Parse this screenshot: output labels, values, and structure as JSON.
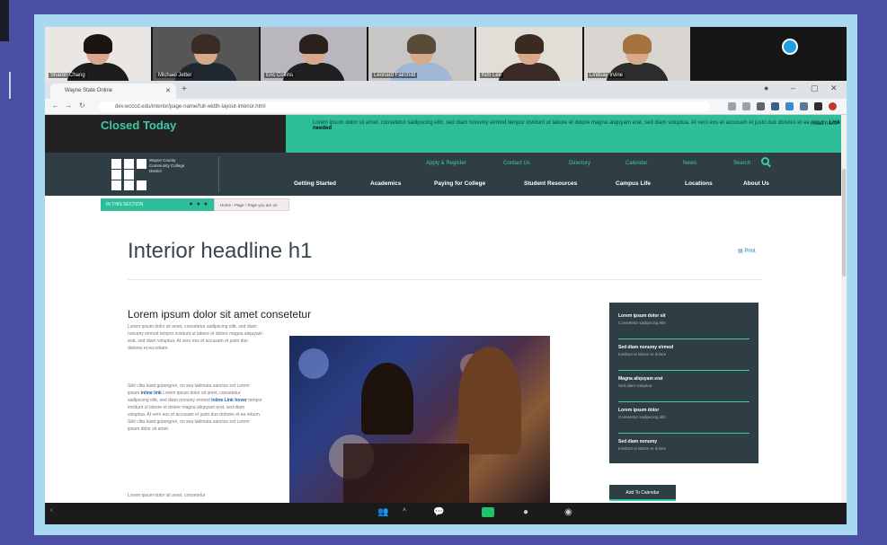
{
  "participants": [
    {
      "name": "Sharon Chang",
      "bg": "#e9e6e3",
      "hair": "#1b1410",
      "shirt": "#1d1d1d"
    },
    {
      "name": "Michael Jetter",
      "bg": "#565656",
      "hair": "#3a2c24",
      "shirt": "#1f2731"
    },
    {
      "name": "Eric Collins",
      "bg": "#b9b7bd",
      "hair": "#2a211c",
      "shirt": "#202020"
    },
    {
      "name": "Leonard Fairchild",
      "bg": "#c8c6c4",
      "hair": "#5a4a3a",
      "shirt": "#9fb6d6"
    },
    {
      "name": "Kim Lee",
      "bg": "#e1ded8",
      "hair": "#3b2a20",
      "shirt": "#3a2a28"
    },
    {
      "name": "Lindsay Irvine",
      "bg": "#d9d6d2",
      "hair": "#a6733f",
      "shirt": "#2c2c2c"
    }
  ],
  "browser": {
    "tab_title": "Wayne State Online",
    "url": "dev.wcccd.edu/interior/page-name/full-width-layout-interior.html"
  },
  "site": {
    "alert_title": "Closed Today",
    "alert_message": "Lorem ipsum dolor sit amet, consetetur sadipscing elitr, sed diam nonumy eirmod tempor invidunt ut labore et dolore magna aliquyam erat, sed diam voluptua. At vero eos et accusam et justo duo dolores et ea rebum.",
    "alert_link": "Link if needed",
    "alert_more": "Read more",
    "logo_text": "Wayne County Community College District",
    "utility_nav": [
      "Apply & Register",
      "Contact Us",
      "Directory",
      "Calendar",
      "News"
    ],
    "search_label": "Search",
    "main_nav": [
      "Getting Started",
      "Academics",
      "Paying for College",
      "Student Resources",
      "Campus Life",
      "Locations",
      "About Us"
    ],
    "crumb_label": "IN THIS SECTION",
    "crumb_path": "Home › Page › Page you are on",
    "h1": "Interior headline h1",
    "print_label": "Print",
    "h2": "Lorem ipsum dolor sit amet consetetur",
    "para1": "Lorem ipsum dolor sit amet, consetetur sadipscing elitr, sed diam nonumy eirmod tempor invidunt ut labore et dolore magna aliquyam erat, sed diam voluptua. At vero eos et accusam et justo duo dolores et ea rebum.",
    "para2_a": "Stet clita kasd gubergren, no sea takimata sanctus est Lorem ipsum",
    "inline_link_1": "inline link",
    "para2_b": "Lorem ipsum dolor sit amet, consetetur sadipscing elitr, sed diam nonumy eirmod",
    "inline_link_2": "inline Link hover",
    "para2_c": "tempor invidunt ut labore et dolore magna aliquyam erat, sed diam voluptua. At vero eos et accusam et justo duo dolores et ea rebum. Stet clita kasd gubergren, no sea takimata sanctus est Lorem ipsum dolor sit amet.",
    "para3": "Lorem ipsum dolor sit amet, consetetur",
    "sidebar": [
      {
        "title": "Lorem ipsum dolor sit",
        "sub": "Consetetur sadipscing elitr"
      },
      {
        "title": "Sed diam nonumy eirmod",
        "sub": "Invidunt ut labore et dolore"
      },
      {
        "title": "Magna aliquyam erat",
        "sub": "Sed diam voluptua"
      },
      {
        "title": "Lorem ipsum dolor",
        "sub": "Consetetur sadipscing elitr"
      },
      {
        "title": "Sed diam nonumy",
        "sub": "Invidunt ut labore et dolore"
      }
    ],
    "calendar_button": "Add To Calendar"
  },
  "colors": {
    "accent": "#3ec9a6",
    "dark": "#2f3e44",
    "frame": "#a9d8f2",
    "backdrop": "#4a4fa3"
  }
}
